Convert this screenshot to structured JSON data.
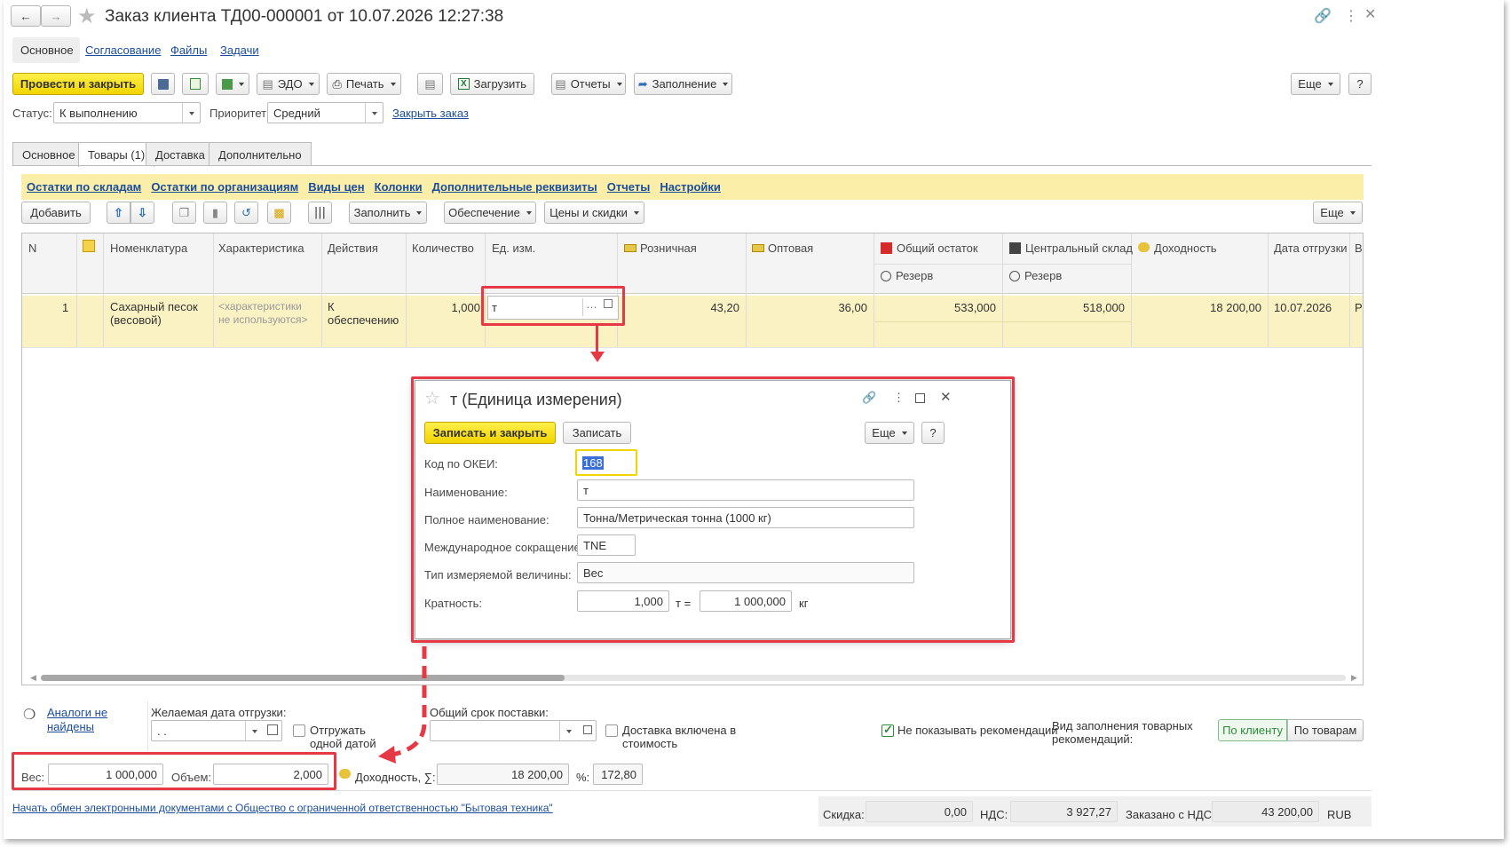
{
  "title": "Заказ клиента ТД00-000001 от 10.07.2026 12:27:38",
  "nav_tabs": [
    "Основное",
    "Согласование",
    "Файлы",
    "Задачи"
  ],
  "toolbar": {
    "post_close": "Провести и закрыть",
    "edo": "ЭДО",
    "print": "Печать",
    "load": "Загрузить",
    "reports": "Отчеты",
    "fill": "Заполнение",
    "more": "Еще",
    "help": "?"
  },
  "status": {
    "label": "Статус:",
    "value": "К выполнению",
    "priority_label": "Приоритет:",
    "priority_value": "Средний",
    "close_link": "Закрыть заказ"
  },
  "tabs": [
    "Основное",
    "Товары (1)",
    "Доставка",
    "Дополнительно"
  ],
  "info_links": [
    "Остатки по складам",
    "Остатки по организациям",
    "Виды цен",
    "Колонки",
    "Дополнительные реквизиты",
    "Отчеты",
    "Настройки"
  ],
  "table_toolbar": {
    "add": "Добавить",
    "fill": "Заполнить",
    "supply": "Обеспечение",
    "prices": "Цены и скидки",
    "more": "Еще"
  },
  "columns": {
    "n": "N",
    "nomenclature": "Номенклатура",
    "characteristic": "Характеристика",
    "actions": "Действия",
    "qty": "Количество",
    "unit": "Ед. изм.",
    "retail": "Розничная",
    "wholesale": "Оптовая",
    "total_stock": "Общий остаток",
    "central": "Центральный склад",
    "reserve": "Резерв",
    "profit": "Доходность",
    "ship_date": "Дата отгрузки",
    "more": "В"
  },
  "row": {
    "n": "1",
    "nomenclature": "Сахарный песок (весовой)",
    "characteristic": "<характеристики не используются>",
    "actions": "К обеспечению",
    "qty": "1,000",
    "unit": "т",
    "retail": "43,20",
    "wholesale": "36,00",
    "total_stock": "533,000",
    "central": "518,000",
    "profit": "18 200,00",
    "ship_date": "10.07.2026",
    "more": "Р"
  },
  "dialog": {
    "title": "т (Единица измерения)",
    "save_close": "Записать и закрыть",
    "save": "Записать",
    "more": "Еще",
    "help": "?",
    "okei_label": "Код по ОКЕИ:",
    "okei": "168",
    "name_label": "Наименование:",
    "name": "т",
    "full_label": "Полное наименование:",
    "full": "Тонна/Метрическая тонна (1000 кг)",
    "intl_label": "Международное сокращение:",
    "intl": "TNE",
    "type_label": "Тип измеряемой величины:",
    "type": "Вес",
    "mult_label": "Кратность:",
    "mult": "1,000",
    "mult_unit": "т =",
    "mult_value": "1 000,000",
    "mult_base": "кг"
  },
  "bottom": {
    "analogs": "Аналоги не найдены",
    "ship_date_label": "Желаемая дата отгрузки:",
    "ship_date_value": ". .",
    "one_date": "Отгружать одной датой",
    "term_label": "Общий срок поставки:",
    "delivery_incl": "Доставка включена в стоимость",
    "no_recs": "Не показывать рекомендации",
    "recs_label": "Вид заполнения товарных рекомендаций:",
    "by_client": "По клиенту",
    "by_goods": "По товарам",
    "weight_label": "Вес:",
    "weight": "1 000,000",
    "volume_label": "Объем:",
    "volume": "2,000",
    "profit_label": "Доходность, ∑:",
    "profit": "18 200,00",
    "pct_label": "%:",
    "pct": "172,80"
  },
  "footer": {
    "edo_link": "Начать обмен электронными документами с Общество с ограниченной ответственностью \"Бытовая техника\"",
    "discount_label": "Скидка:",
    "discount": "0,00",
    "vat_label": "НДС:",
    "vat": "3 927,27",
    "total_label": "Заказано с НДС:",
    "total": "43 200,00",
    "currency": "RUB"
  },
  "colors": {
    "accent_yellow": "#f2d400",
    "highlight_red": "#e53945",
    "link": "#1a4d9c"
  }
}
